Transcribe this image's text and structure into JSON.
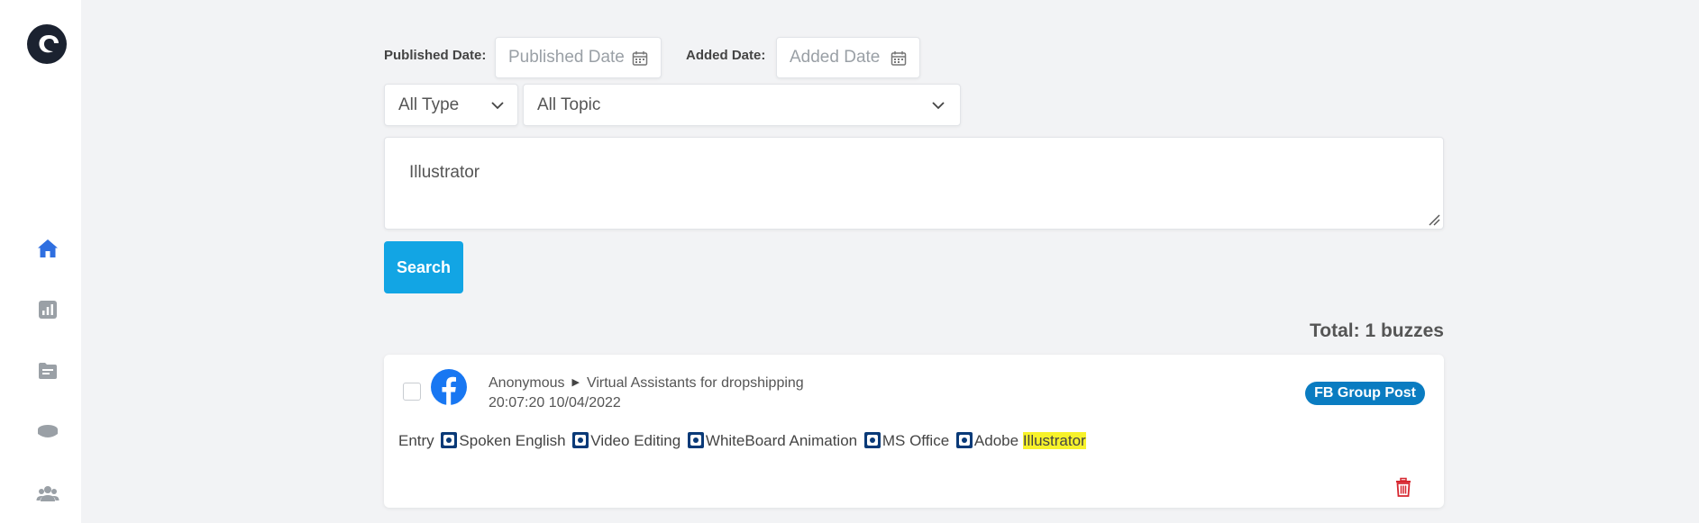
{
  "filters": {
    "published_label": "Published Date:",
    "published_placeholder": "Published Date",
    "added_label": "Added Date:",
    "added_placeholder": "Added Date",
    "type_select": "All Type",
    "topic_select": "All Topic"
  },
  "search": {
    "query": "Illustrator",
    "button_label": "Search"
  },
  "results": {
    "total_label": "Total: 1 buzzes",
    "items": [
      {
        "author": "Anonymous",
        "group": "Virtual Assistants for dropshipping",
        "timestamp": "20:07:20 10/04/2022",
        "badge": "FB Group Post",
        "content_prefix": "Entry",
        "tags": [
          "Spoken English",
          "Video Editing",
          "WhiteBoard Animation",
          "MS Office",
          "Adobe"
        ],
        "highlight": "Illustrator"
      }
    ]
  },
  "sidebar": {
    "icons": [
      "logo-icon",
      "home-icon",
      "analytics-icon",
      "folder-icon",
      "database-icon",
      "users-icon"
    ],
    "active": "home-icon"
  },
  "colors": {
    "accent": "#12a5e4",
    "badge": "#0a7cc1",
    "nav_active": "#2f6fe0",
    "delete": "#d6262f",
    "highlight": "#f7f22a"
  }
}
